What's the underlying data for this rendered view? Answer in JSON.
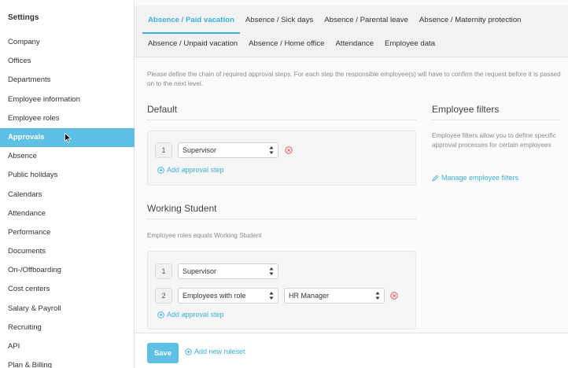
{
  "sidebar": {
    "title": "Settings",
    "items": [
      {
        "label": "Company"
      },
      {
        "label": "Offices"
      },
      {
        "label": "Departments"
      },
      {
        "label": "Employee information"
      },
      {
        "label": "Employee roles"
      },
      {
        "label": "Approvals",
        "active": true
      },
      {
        "label": "Absence"
      },
      {
        "label": "Public holidays"
      },
      {
        "label": "Calendars"
      },
      {
        "label": "Attendance"
      },
      {
        "label": "Performance"
      },
      {
        "label": "Documents"
      },
      {
        "label": "On-/Offboarding"
      },
      {
        "label": "Cost centers"
      },
      {
        "label": "Salary & Payroll"
      },
      {
        "label": "Recruiting"
      },
      {
        "label": "API"
      },
      {
        "label": "Plan & Billing"
      }
    ]
  },
  "tabs": {
    "row1": [
      {
        "label": "Absence / Paid vacation",
        "active": true
      },
      {
        "label": "Absence / Sick days"
      },
      {
        "label": "Absence / Parental leave"
      },
      {
        "label": "Absence / Maternity protection"
      }
    ],
    "row2": [
      {
        "label": "Absence / Unpaid vacation"
      },
      {
        "label": "Absence / Home office"
      },
      {
        "label": "Attendance"
      },
      {
        "label": "Employee data"
      }
    ]
  },
  "intro": "Please define the chain of required approval steps. For each step the responsible employee(s) will have to confirm the request before it is passed on to the next level.",
  "default_section": {
    "title": "Default",
    "steps": [
      {
        "number": "1",
        "approver": "Supervisor"
      }
    ],
    "add_step_label": "Add approval step"
  },
  "working_student_section": {
    "title": "Working Student",
    "condition": "Employee roles equals Working Student",
    "steps": [
      {
        "number": "1",
        "approver": "Supervisor"
      },
      {
        "number": "2",
        "approver": "Employees with role",
        "role": "HR Manager"
      }
    ],
    "add_step_label": "Add approval step"
  },
  "filters": {
    "title": "Employee filters",
    "description": "Employee filters allow you to define specific approval processes for certain employees",
    "manage_label": "Manage employee filters"
  },
  "footer": {
    "save_label": "Save",
    "add_ruleset_label": "Add new ruleset"
  },
  "colors": {
    "accent": "#5fc0e6",
    "link": "#3ab0de",
    "remove": "#e05a5a"
  }
}
